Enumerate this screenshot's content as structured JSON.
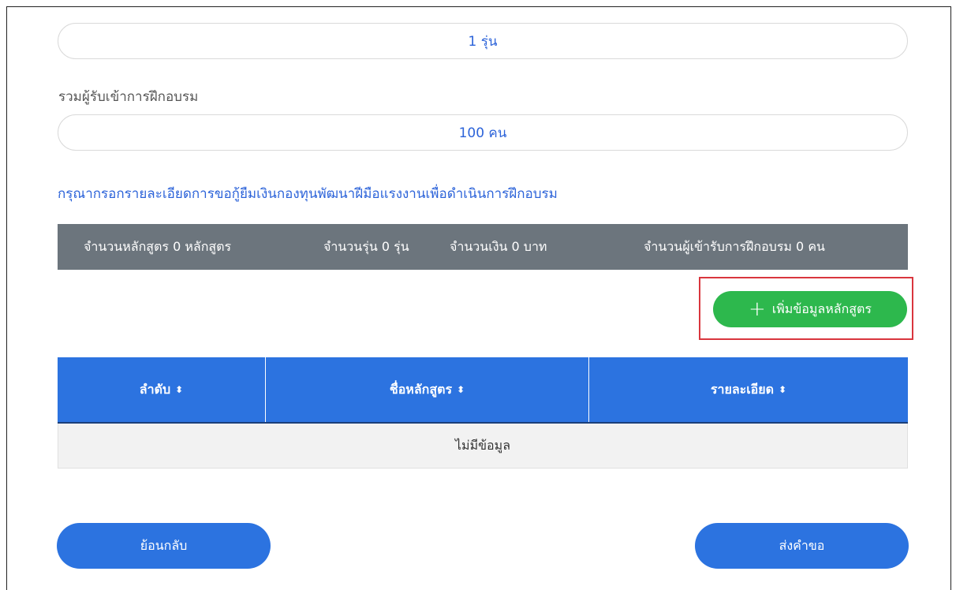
{
  "fields": {
    "batch_value": "1 รุ่น",
    "trainees_label": "รวมผู้รับเข้าการฝึกอบรม",
    "trainees_value": "100 คน"
  },
  "section": {
    "instruction": "กรุณากรอกรายละเอียดการขอกู้ยืมเงินกองทุนพัฒนาฝีมือแรงงานเพื่อดำเนินการฝึกอบรม"
  },
  "summary": {
    "courses": "จำนวนหลักสูตร 0 หลักสูตร",
    "batches": "จำนวนรุ่น 0 รุ่น",
    "money": "จำนวนเงิน 0 บาท",
    "trainees": "จำนวนผู้เข้ารับการฝึกอบรม 0 คน"
  },
  "add_button": {
    "icon": "plus-icon",
    "label": "เพิ่มข้อมูลหลักสูตร"
  },
  "table": {
    "columns": [
      {
        "label": "ลำดับ",
        "sort_icon": "sort-icon"
      },
      {
        "label": "ชื่อหลักสูตร",
        "sort_icon": "sort-icon"
      },
      {
        "label": "รายละเอียด",
        "sort_icon": "sort-icon"
      }
    ],
    "empty_text": "ไม่มีข้อมูล"
  },
  "footer": {
    "back_label": "ย้อนกลับ",
    "submit_label": "ส่งคำขอ"
  },
  "colors": {
    "primary_blue": "#2c73e0",
    "link_blue": "#2c63d9",
    "summary_gray": "#6c757d",
    "add_green": "#2db84d",
    "highlight_red": "#d9363e"
  }
}
